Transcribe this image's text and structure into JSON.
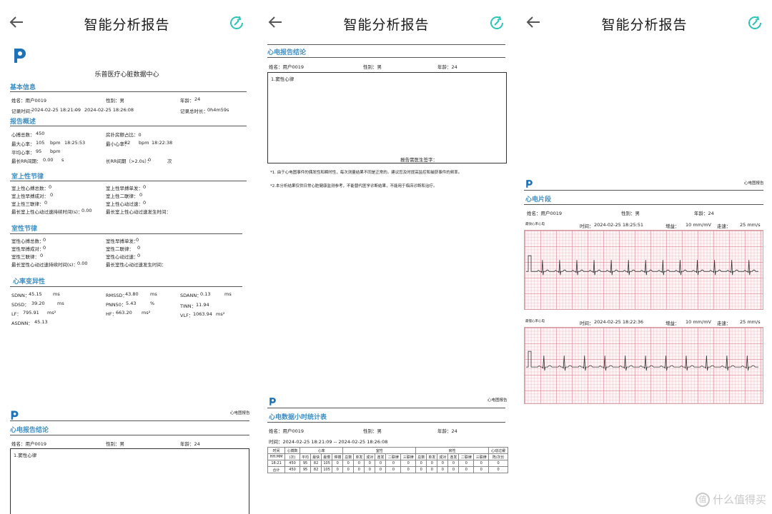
{
  "app": {
    "title": "智能分析报告"
  },
  "page1": {
    "center_name": "乐普医疗心脏数据中心",
    "basic": {
      "title": "基本信息",
      "name": "姓名：用户0019",
      "gender": "性别：男",
      "age_label": "年龄：",
      "age": "24",
      "record_time_label": "记录时间：",
      "record_start": "2024-02-25 18:21:09",
      "dash": "--",
      "record_end": "2024-02-25 18:26:08",
      "duration_label": "记录总时长：",
      "duration": "0h4m59s"
    },
    "overview": {
      "title": "报告概述",
      "total_beats_label": "心搏总数：",
      "total_beats": "450",
      "af_ratio": "房扑房颤占比：0",
      "max_hr_label": "最大心率：",
      "max_hr": "105",
      "bpm1": "bpm",
      "max_hr_time": "18:25:53",
      "min_hr_label": "最小心率：",
      "min_hr": "82",
      "bpm2": "bpm",
      "min_hr_time": "18:22:38",
      "avg_hr_label": "平均心率：",
      "avg_hr": "95",
      "bpm3": "bpm",
      "max_rr_label": "最长RR间期：",
      "max_rr": "0.00",
      "sec": "s",
      "long_rr_label": "长RR间期（>2.0s）：",
      "long_rr": "0",
      "times": "次"
    },
    "sv": {
      "title": "室上性节律",
      "l1": "室上性心搏总数：",
      "v1": "0",
      "r1": "室上性早搏单发：",
      "rv1": "0",
      "l2": "室上性早搏成对：",
      "v2": "0",
      "r2": "室上性二联律：",
      "rv2": "0",
      "l3": "室上性三联律：",
      "v3": "0",
      "r3": "室上性心动过速：",
      "rv3": "0",
      "l4": "最长室上性心动过速持续时间(s)：",
      "v4": "0.00",
      "r4": "最长室上性心动过速发生时间："
    },
    "v": {
      "title": "室性节律",
      "l1": "室性心搏总数：",
      "v1": "0",
      "r1": "室性早搏单发：",
      "rv1": "0",
      "l2": "室性早搏成对：",
      "v2": "0",
      "r2": "室性二联律：",
      "rv2": "0",
      "l3": "室性三联律：",
      "v3": "0",
      "r3": "室性心动过速：",
      "rv3": "0",
      "l4": "最长室性心动过速持续时间(s)：",
      "v4": "0.00",
      "r4": "最长室性心动过速发生时间："
    },
    "hrv": {
      "title": "心率变异性",
      "sdnn": "SDNN：",
      "sdnn_v": "45.15",
      "ms1": "ms",
      "rmssd": "RMSSD：",
      "rmssd_v": "43.80",
      "ms2": "ms",
      "sdann": "SDANN：",
      "sdann_v": "0.13",
      "ms3": "ms",
      "sdsd": "SDSD：",
      "sdsd_v": "39.20",
      "ms4": "ms",
      "pnn50": "PNN50：",
      "pnn50_v": "5.43",
      "pct": "%",
      "tinn": "TINN：",
      "tinn_v": "11.94",
      "lf": "LF：",
      "lf_v": "795.91",
      "ms2a": "ms²",
      "hf": "HF：",
      "hf_v": "663.20",
      "ms2b": "ms²",
      "vlf": "VLF：",
      "vlf_v": "1063.94",
      "ms2c": "ms²",
      "asdnn": "ASDNN：",
      "asdnn_v": "45.13"
    },
    "footer_page": {
      "header_right": "心电图报告",
      "title": "心电报告结论",
      "name": "姓名：用户0019",
      "gender": "性别：男",
      "age": "年龄：24",
      "conclusion": "1.窦性心律"
    }
  },
  "page2": {
    "conclusion_title": "心电报告结论",
    "name": "姓名：用户0019",
    "gender": "性别：男",
    "age": "年龄：24",
    "conclusion": "1.窦性心律",
    "signature": "报告需医生签字：",
    "note1": "*1. 由于心电图事件的偶发性和瞬时性，每次测量结果不同是正常的。建议您及时提高监控和捕获事件的频率。",
    "note2": "*2.本分析结果仅供日常心脏健康监测参考，不能替代医学诊断结果，不能用于临床诊断和治疗。",
    "header_right": "心电图报告",
    "stats_title": "心电数据小时统计表",
    "stats_name": "姓名：用户0019",
    "stats_gender": "性别：男",
    "stats_age": "年龄：24",
    "stats_time": "时间：2024-02-25 18:21:09    -- 2024-02-25 18:26:08",
    "table": {
      "h1": [
        "时间",
        "心搏数",
        "心率",
        "室性",
        "房性",
        "心动过缓"
      ],
      "h2": [
        "HH:MM",
        "(次)",
        "平均",
        "最快",
        "最慢",
        "停搏",
        "总数",
        "单发",
        "成对",
        "连发",
        "二联律",
        "三联律",
        "总数",
        "单发",
        "成对",
        "连发",
        "二联律",
        "三联律",
        "阵/次长"
      ],
      "rows": [
        [
          "18:21",
          "450",
          "95",
          "82",
          "105",
          "0",
          "0",
          "0",
          "0",
          "0",
          "0",
          "0",
          "0",
          "0",
          "0",
          "0",
          "0",
          "0",
          "0"
        ],
        [
          "合计",
          "450",
          "95",
          "82",
          "105",
          "0",
          "0",
          "0",
          "0",
          "0",
          "0",
          "0",
          "0",
          "0",
          "0",
          "0",
          "0",
          "0",
          "0"
        ]
      ]
    }
  },
  "page3": {
    "header_right": "心电图报告",
    "title": "心电片段",
    "name": "姓名：用户0019",
    "gender": "性别：男",
    "age": "年龄：24",
    "strip1": {
      "label": "最快心率心电",
      "time_label": "时间：",
      "time": "2024-02-25 18:25:51",
      "gain_label": "增益：",
      "gain": "10 mm/mV",
      "speed_label": "走速：",
      "speed": "25 mm/s",
      "beats": 13
    },
    "strip2": {
      "label": "最慢心率心电",
      "time_label": "时间：",
      "time": "2024-02-25 18:22:36",
      "gain_label": "增益：",
      "gain": "10 mm/mV",
      "speed_label": "走速：",
      "speed": "25 mm/s",
      "beats": 11
    }
  },
  "watermark": "什么值得买",
  "accent": "#3d8fc4",
  "share_color": "#2ec4b6"
}
